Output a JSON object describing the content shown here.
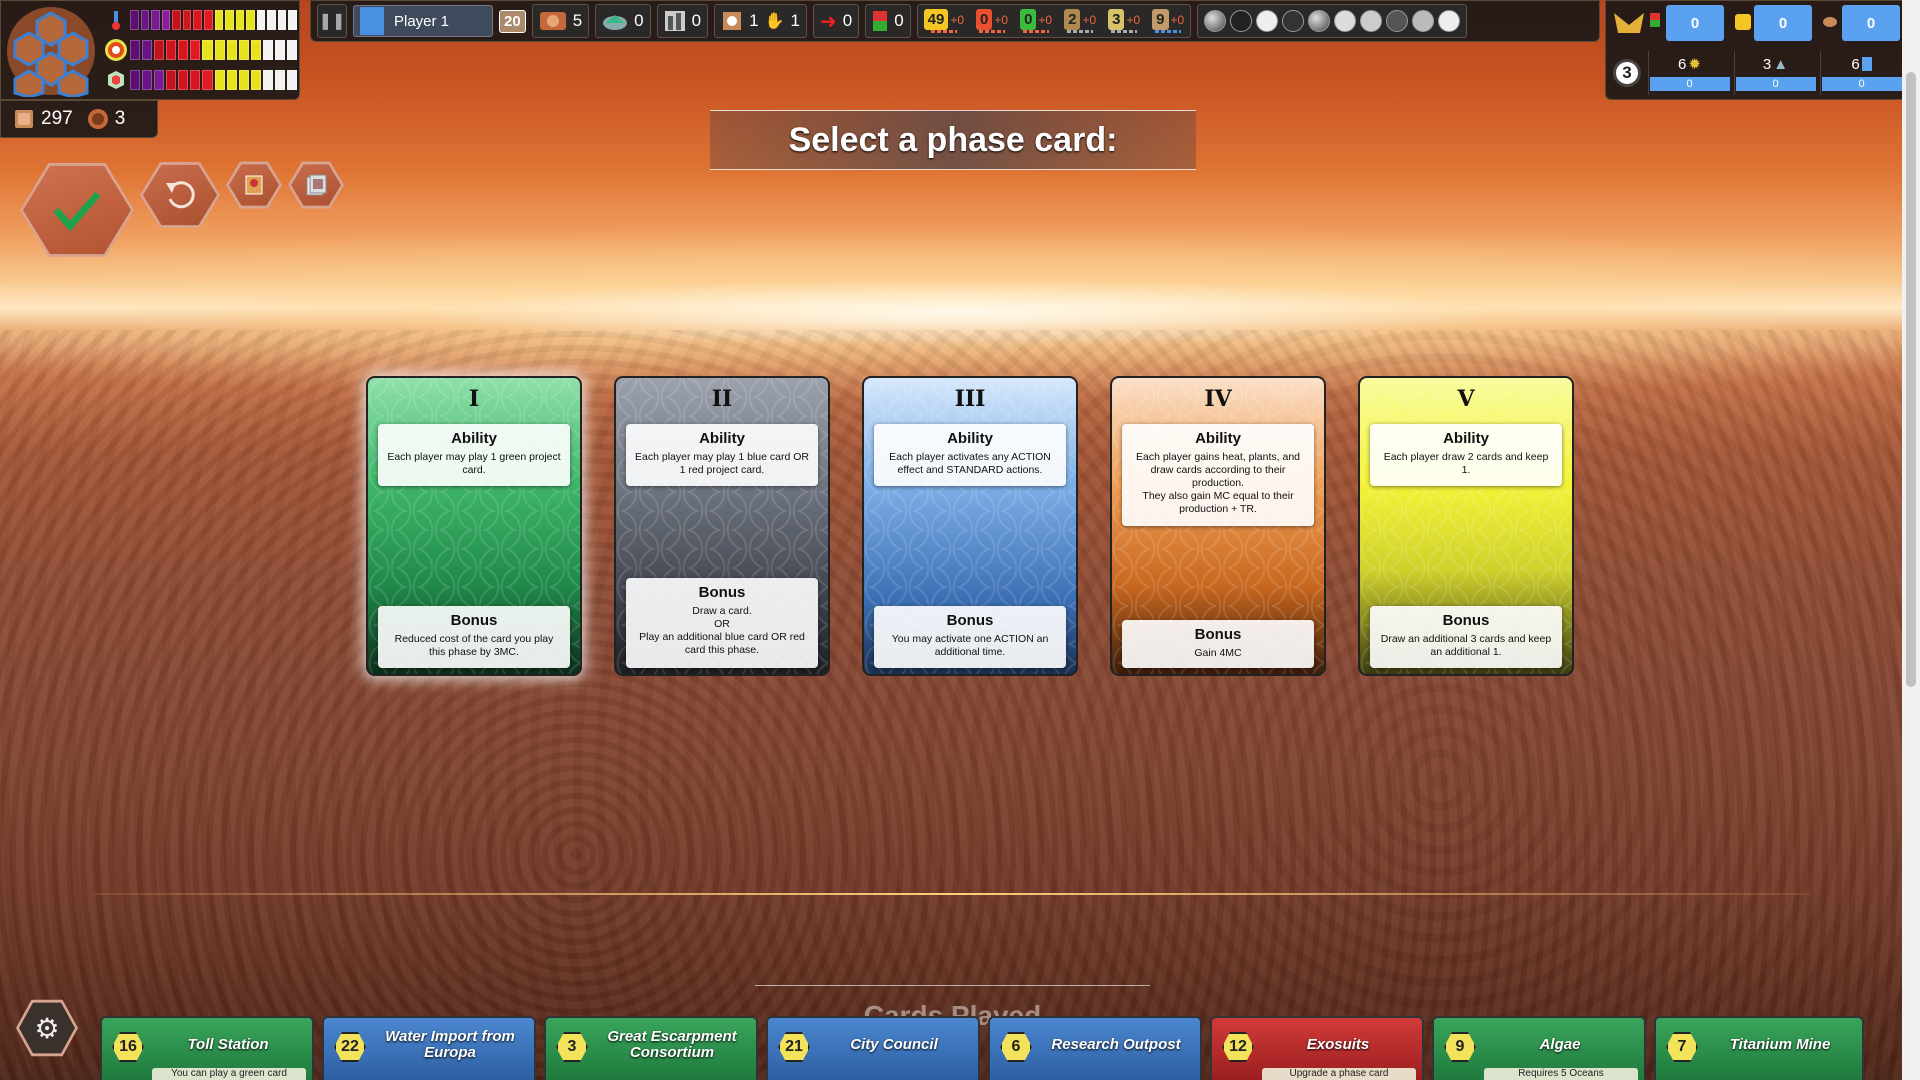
{
  "meters": {
    "rows": [
      {
        "icon": "thermometer-icon",
        "color": "#4a90e2"
      },
      {
        "icon": "oxygen-icon",
        "color": "#e64a19"
      },
      {
        "icon": "ocean-icon",
        "color": "#8fd48a"
      }
    ]
  },
  "resources": {
    "money": "297",
    "tr": "3"
  },
  "topbar": {
    "player_name": "Player 1",
    "generation": "20",
    "stats": [
      {
        "icon": "tr-icon",
        "value": "5"
      },
      {
        "icon": "greenery-icon",
        "value": "0"
      },
      {
        "icon": "city-icon",
        "value": "0"
      },
      {
        "icon": "cards-hand-icon",
        "value": "1"
      },
      {
        "icon": "hand-icon",
        "value": "1"
      },
      {
        "icon": "arrow-right-icon",
        "value": "0"
      },
      {
        "icon": "played-cards-icon",
        "value": "0"
      }
    ],
    "production": [
      {
        "icon": "mc-icon",
        "value": "49",
        "delta": "+0",
        "color": "#f3c623"
      },
      {
        "icon": "heat-icon",
        "value": "0",
        "delta": "+0",
        "color": "#e8502f"
      },
      {
        "icon": "plant-icon",
        "value": "0",
        "delta": "+0",
        "color": "#3bbb3b"
      },
      {
        "icon": "steel-icon",
        "value": "2",
        "delta": "+0",
        "color": "#b08850"
      },
      {
        "icon": "titanium-icon",
        "value": "3",
        "delta": "+0",
        "color": "#d7c46a"
      },
      {
        "icon": "cards-icon",
        "value": "9",
        "delta": "+0",
        "color": "#c29b6a"
      }
    ],
    "tags": [
      "earth-tag-icon",
      "space-tag-icon",
      "science-tag-icon",
      "power-tag-icon",
      "jovian-tag-icon",
      "building-tag-icon",
      "plant-tag-icon",
      "animal-tag-icon",
      "microbe-tag-icon",
      "event-tag-icon"
    ]
  },
  "right_panel": {
    "top": [
      {
        "icon": "milestone-icon",
        "value": "0"
      },
      {
        "icon": "award-icon",
        "value": "0"
      },
      {
        "icon": "other-icon",
        "value": "0"
      }
    ],
    "round": "3",
    "cells": [
      {
        "top": "6",
        "icon": "sun-icon",
        "bottom": "0"
      },
      {
        "top": "3",
        "icon": "forest-icon",
        "bottom": "0"
      },
      {
        "top": "6",
        "icon": "blue-square-icon",
        "bottom": "0"
      }
    ]
  },
  "title": "Select a phase card:",
  "phase_cards": [
    {
      "numeral": "I",
      "ability_title": "Ability",
      "ability": "Each player may play 1 green project card.",
      "bonus_title": "Bonus",
      "bonus": "Reduced cost of the card you play this phase by 3MC."
    },
    {
      "numeral": "II",
      "ability_title": "Ability",
      "ability": "Each player may play 1 blue card OR 1 red project card.",
      "bonus_title": "Bonus",
      "bonus": "Draw a card.\nOR\nPlay an additional blue card OR red card this phase."
    },
    {
      "numeral": "III",
      "ability_title": "Ability",
      "ability": "Each player activates any ACTION effect and STANDARD actions.",
      "bonus_title": "Bonus",
      "bonus": "You may activate one ACTION an additional time."
    },
    {
      "numeral": "IV",
      "ability_title": "Ability",
      "ability": "Each player gains heat, plants, and draw cards according to their production.\nThey also gain MC equal to their production + TR.",
      "bonus_title": "Bonus",
      "bonus": "Gain 4MC"
    },
    {
      "numeral": "V",
      "ability_title": "Ability",
      "ability": "Each player draw 2 cards and keep 1.",
      "bonus_title": "Bonus",
      "bonus": "Draw an additional 3 cards and keep an additional 1."
    }
  ],
  "played_title": "Cards Played",
  "played_cards": [
    {
      "cost": "16",
      "name": "Toll Station",
      "color": "green",
      "note": "You can play a green card"
    },
    {
      "cost": "22",
      "name": "Water Import from Europa",
      "color": "blue",
      "note": ""
    },
    {
      "cost": "3",
      "name": "Great Escarpment Consortium",
      "color": "green",
      "note": ""
    },
    {
      "cost": "21",
      "name": "City Council",
      "color": "blue",
      "note": ""
    },
    {
      "cost": "6",
      "name": "Research Outpost",
      "color": "blue",
      "note": ""
    },
    {
      "cost": "12",
      "name": "Exosuits",
      "color": "red",
      "note": "Upgrade a phase card"
    },
    {
      "cost": "9",
      "name": "Algae",
      "color": "green",
      "note": "Requires 5 Oceans"
    },
    {
      "cost": "7",
      "name": "Titanium Mine",
      "color": "green",
      "note": ""
    }
  ]
}
